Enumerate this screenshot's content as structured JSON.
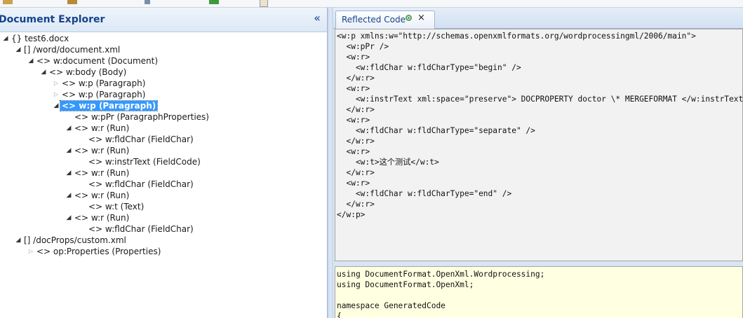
{
  "explorer": {
    "title": "Document Explorer",
    "collapse_glyph": "«",
    "nodes": [
      {
        "label": "{} test6.docx",
        "indent": 0,
        "state": "open"
      },
      {
        "label": "[] /word/document.xml",
        "indent": 1,
        "state": "open"
      },
      {
        "label": "<> w:document (Document)",
        "indent": 2,
        "state": "open"
      },
      {
        "label": "<> w:body (Body)",
        "indent": 3,
        "state": "open"
      },
      {
        "label": "<> w:p (Paragraph)",
        "indent": 4,
        "state": "closed"
      },
      {
        "label": "<> w:p (Paragraph)",
        "indent": 4,
        "state": "closed"
      },
      {
        "label": "<> w:p (Paragraph)",
        "indent": 4,
        "state": "open",
        "selected": true
      },
      {
        "label": "<> w:pPr (ParagraphProperties)",
        "indent": 5,
        "state": "leaf"
      },
      {
        "label": "<> w:r (Run)",
        "indent": 5,
        "state": "open"
      },
      {
        "label": "<> w:fldChar (FieldChar)",
        "indent": 6,
        "state": "leaf"
      },
      {
        "label": "<> w:r (Run)",
        "indent": 5,
        "state": "open"
      },
      {
        "label": "<> w:instrText (FieldCode)",
        "indent": 6,
        "state": "leaf"
      },
      {
        "label": "<> w:r (Run)",
        "indent": 5,
        "state": "open"
      },
      {
        "label": "<> w:fldChar (FieldChar)",
        "indent": 6,
        "state": "leaf"
      },
      {
        "label": "<> w:r (Run)",
        "indent": 5,
        "state": "open"
      },
      {
        "label": "<> w:t (Text)",
        "indent": 6,
        "state": "leaf"
      },
      {
        "label": "<> w:r (Run)",
        "indent": 5,
        "state": "open"
      },
      {
        "label": "<> w:fldChar (FieldChar)",
        "indent": 6,
        "state": "leaf"
      },
      {
        "label": "[] /docProps/custom.xml",
        "indent": 1,
        "state": "open"
      },
      {
        "label": "<> op:Properties (Properties)",
        "indent": 2,
        "state": "closed"
      }
    ]
  },
  "tab": {
    "label": "Reflected Code",
    "pin_icon": "pin-icon",
    "close_glyph": "×"
  },
  "reflected_xml": "<w:p xmlns:w=\"http://schemas.openxmlformats.org/wordprocessingml/2006/main\">\n  <w:pPr />\n  <w:r>\n    <w:fldChar w:fldCharType=\"begin\" />\n  </w:r>\n  <w:r>\n    <w:instrText xml:space=\"preserve\"> DOCPROPERTY doctor \\* MERGEFORMAT </w:instrText>\n  </w:r>\n  <w:r>\n    <w:fldChar w:fldCharType=\"separate\" />\n  </w:r>\n  <w:r>\n    <w:t>这个测试</w:t>\n  </w:r>\n  <w:r>\n    <w:fldChar w:fldCharType=\"end\" />\n  </w:r>\n</w:p>",
  "generated_code": "using DocumentFormat.OpenXml.Wordprocessing;\nusing DocumentFormat.OpenXml;\n\nnamespace GeneratedCode\n{",
  "colors": {
    "header_text": "#15428b",
    "selection": "#3399ff",
    "code_bg": "#f2f2f2",
    "generated_bg": "#ffffe1"
  }
}
